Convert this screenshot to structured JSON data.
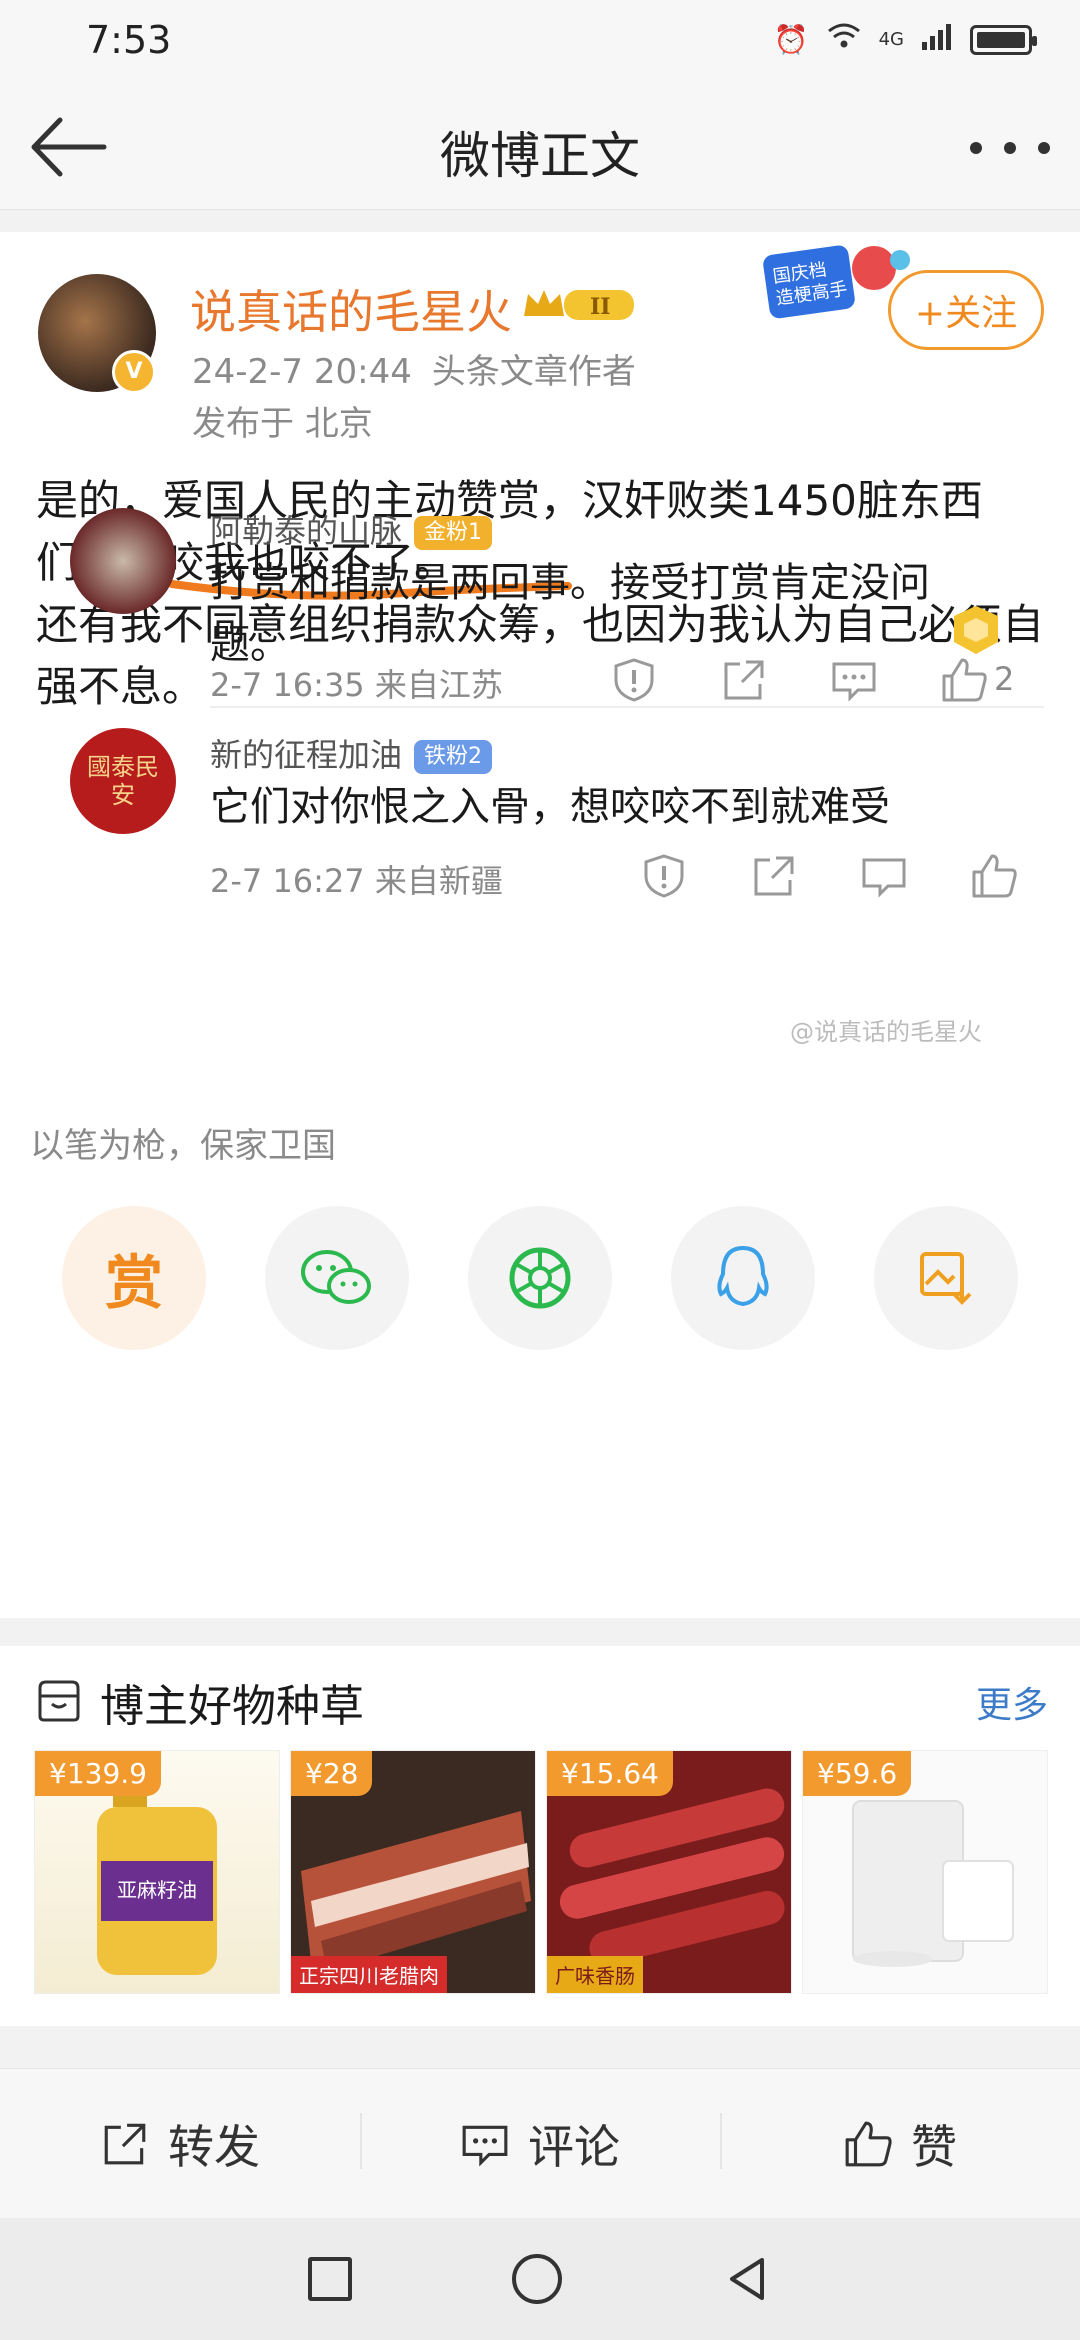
{
  "status_bar": {
    "time": "7:53",
    "network": "4G"
  },
  "nav": {
    "title": "微博正文"
  },
  "post": {
    "author": "说真话的毛星火",
    "level_badge": "II",
    "date": "24-2-7 20:44",
    "author_tag": "头条文章作者",
    "location": "发布于 北京",
    "follow_label": "+关注",
    "promo_badge": "国庆档造梗高手",
    "paragraphs": [
      "是的，爱国人民的主动赞赏，汉奸败类1450脏东西们，想咬我也咬不了。",
      "还有我不同意组织捐款众筹，也因为我认为自己必须自强不息。"
    ]
  },
  "comments": [
    {
      "user": "阿勒泰的山脉",
      "badge": "金粉1",
      "badge_color": "#f2b12d",
      "text": "打赏和捐款是两回事。接受打赏肯定没问题。",
      "time": "2-7 16:35 来自江苏",
      "likes": "2"
    },
    {
      "user": "新的征程加油",
      "badge": "铁粉2",
      "badge_color": "#6a9ae8",
      "avatar_text": "國泰民安",
      "text": "它们对你恨之入骨，想咬咬不到就难受",
      "time": "2-7 16:27 来自新疆",
      "likes": ""
    }
  ],
  "watermark": "@说真话的毛星火",
  "reward_caption": "以笔为枪，保家卫国",
  "share": {
    "reward_label": "赏",
    "buttons": [
      "reward",
      "wechat-icon",
      "moments-icon",
      "qq-icon",
      "save-image-icon"
    ]
  },
  "goods": {
    "title": "博主好物种草",
    "more": "更多",
    "items": [
      {
        "price": "¥139.9",
        "caption": "亚麻籽油"
      },
      {
        "price": "¥28",
        "caption": "正宗四川老腊肉"
      },
      {
        "price": "¥15.64",
        "caption": "广味香肠"
      },
      {
        "price": "¥59.6",
        "caption": ""
      }
    ]
  },
  "actions": {
    "repost": "转发",
    "comment": "评论",
    "like": "赞"
  },
  "colors": {
    "accent": "#f08a1f",
    "link": "#3d7bc9",
    "author": "#e8782e"
  }
}
